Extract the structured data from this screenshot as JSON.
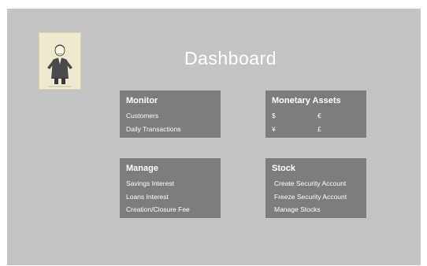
{
  "header": {
    "title": "Dashboard"
  },
  "cards": {
    "monitor": {
      "title": "Monitor",
      "items": [
        "Customers",
        "Daily Transactions"
      ]
    },
    "assets": {
      "title": "Monetary Assets",
      "currencies": [
        "$",
        "€",
        "¥",
        "£"
      ]
    },
    "manage": {
      "title": "Manage",
      "items": [
        "Savings Interest",
        "Loans Interest",
        "Creation/Closure Fee"
      ]
    },
    "stock": {
      "title": "Stock",
      "items": [
        "Create Security Account",
        "Freeze Security Account",
        "Manage Stocks"
      ]
    }
  },
  "colors": {
    "background": "#c4c4c4",
    "card": "#7d7d7d",
    "text": "#ffffff"
  }
}
